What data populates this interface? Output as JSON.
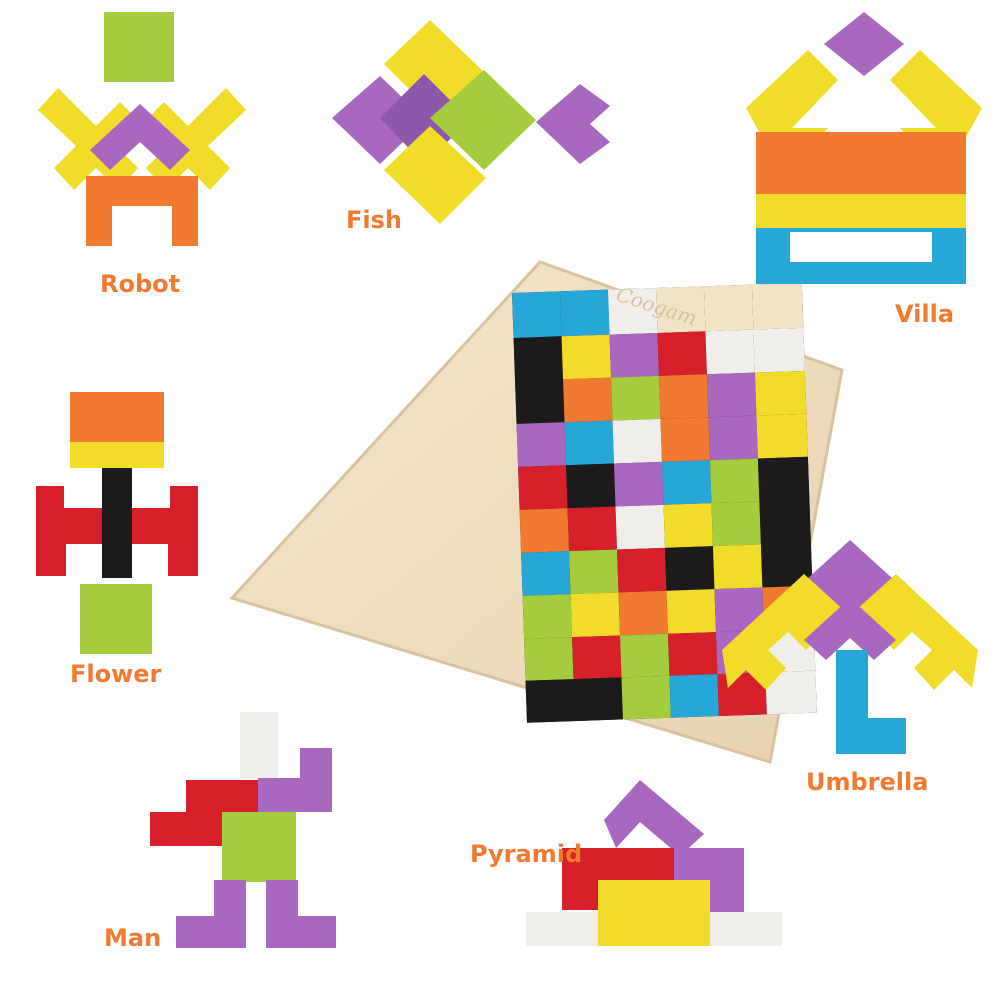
{
  "board": {
    "brand": "Coogam"
  },
  "shapes": [
    {
      "name": "Robot"
    },
    {
      "name": "Fish"
    },
    {
      "name": "Villa"
    },
    {
      "name": "Flower"
    },
    {
      "name": "Umbrella"
    },
    {
      "name": "Pyramid"
    },
    {
      "name": "Man"
    }
  ],
  "colors": {
    "yellow": "#f2dc2a",
    "green": "#a5cc3c",
    "purple": "#a868bf",
    "orange": "#f27a30",
    "red": "#d8202a",
    "blue": "#27a6d8",
    "black": "#1c1a1a",
    "white": "#efeeea",
    "wood": "#f2e2c6",
    "label": "#f07a30"
  }
}
